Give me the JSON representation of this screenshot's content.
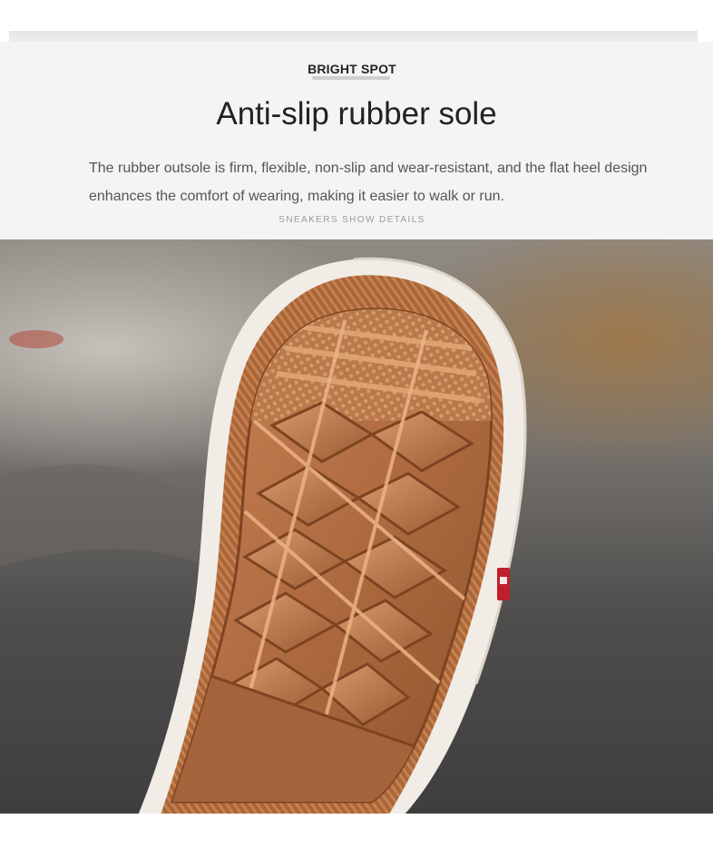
{
  "header": {
    "eyebrow": "BRIGHT SPOT",
    "title": "Anti-slip rubber sole",
    "description": "The rubber outsole is firm, flexible, non-slip and wear-resistant, and the flat heel design enhances the comfort of wearing, making it easier to walk or run.",
    "footnote": "SNEAKERS SHOW DETAILS"
  },
  "photo": {
    "subject": "sneaker-sole",
    "colors": {
      "rubber": "#b5754a",
      "rubber_dark": "#8a4f2a",
      "rim": "#f2ede6",
      "label_red": "#c0202b",
      "background_dark": "#3e3e3f"
    }
  }
}
